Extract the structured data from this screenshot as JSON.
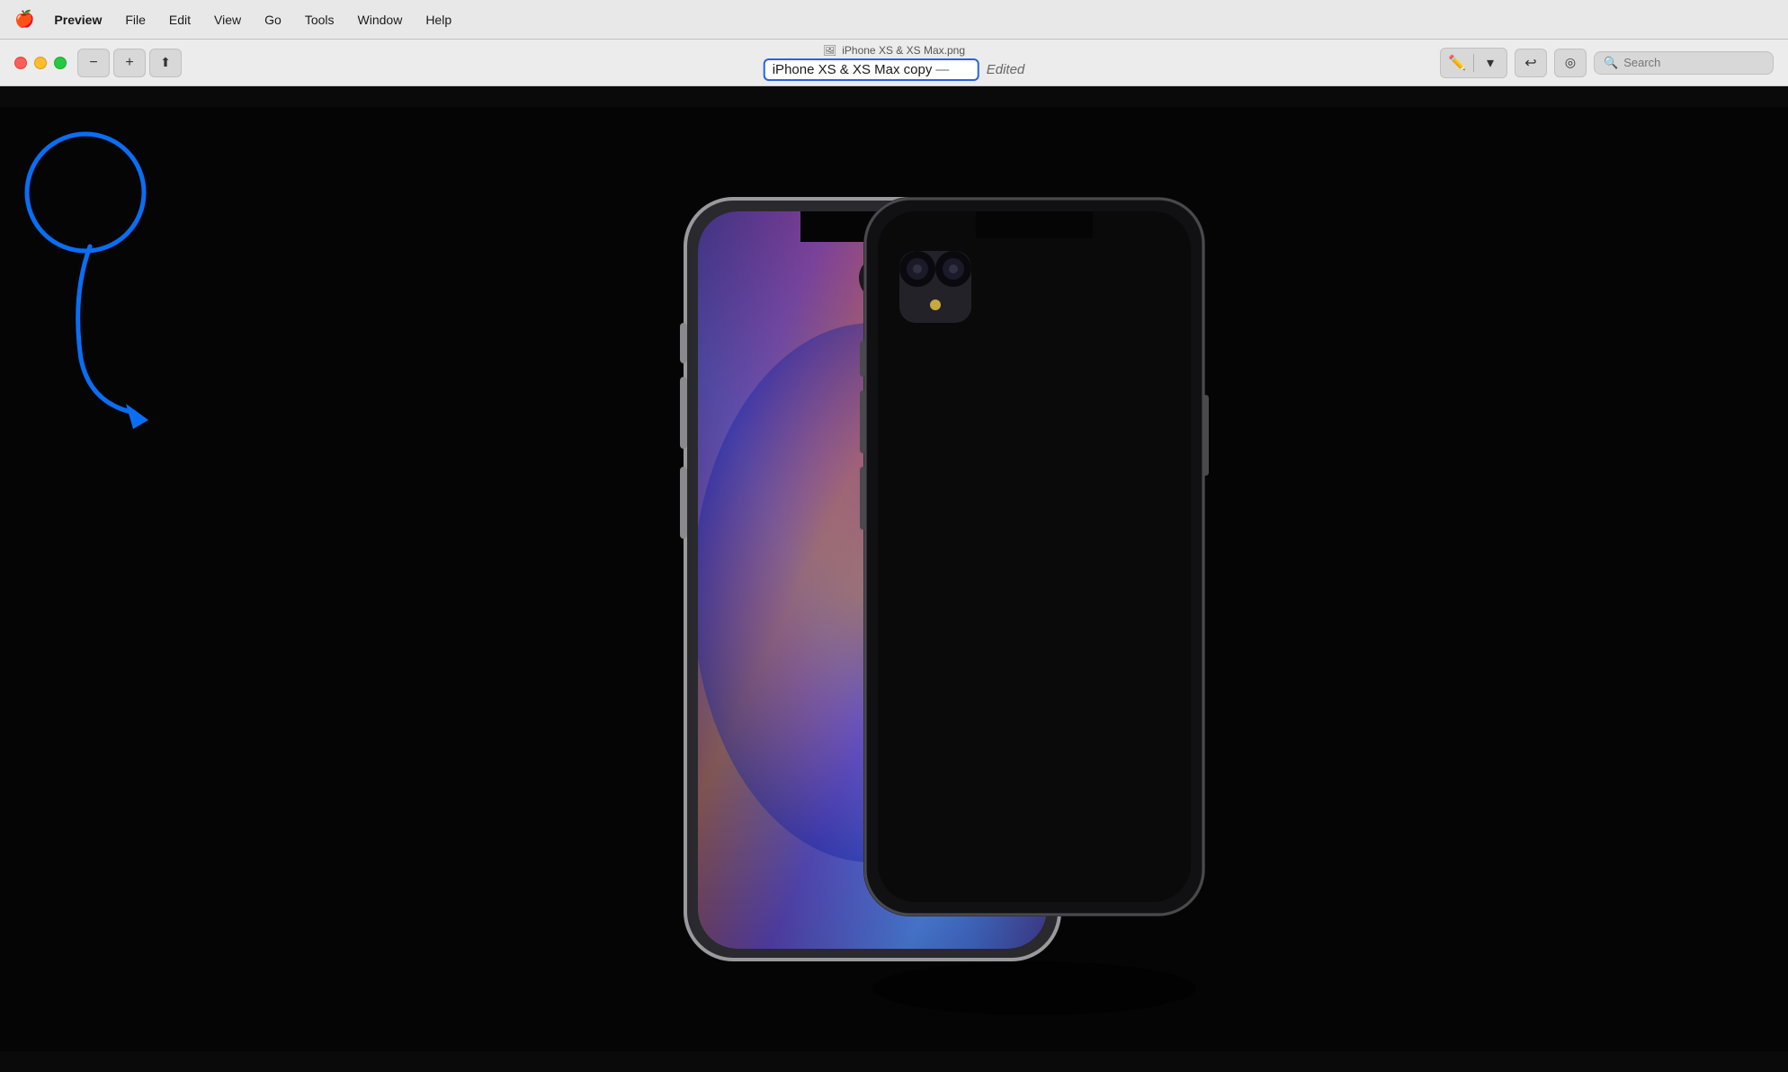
{
  "menubar": {
    "apple_icon": "🍎",
    "items": [
      "Preview",
      "File",
      "Edit",
      "View",
      "Go",
      "Tools",
      "Window",
      "Help"
    ]
  },
  "titlebar": {
    "file_tab": {
      "icon": "📄",
      "name": "iPhone XS & XS Max.png"
    },
    "title": "iPhone XS & XS Max copy",
    "dash": "—",
    "edited_label": "Edited"
  },
  "toolbar": {
    "zoom_out_label": "−",
    "zoom_in_label": "+",
    "share_label": "↑",
    "markup_pen_label": "✏",
    "markup_dropdown_label": "▾",
    "rotate_label": "↩",
    "search_placeholder": "Search",
    "search_icon": "🔍"
  },
  "annotation": {
    "circle_color": "#0a6ef5",
    "arrow_color": "#0a6ef5"
  }
}
